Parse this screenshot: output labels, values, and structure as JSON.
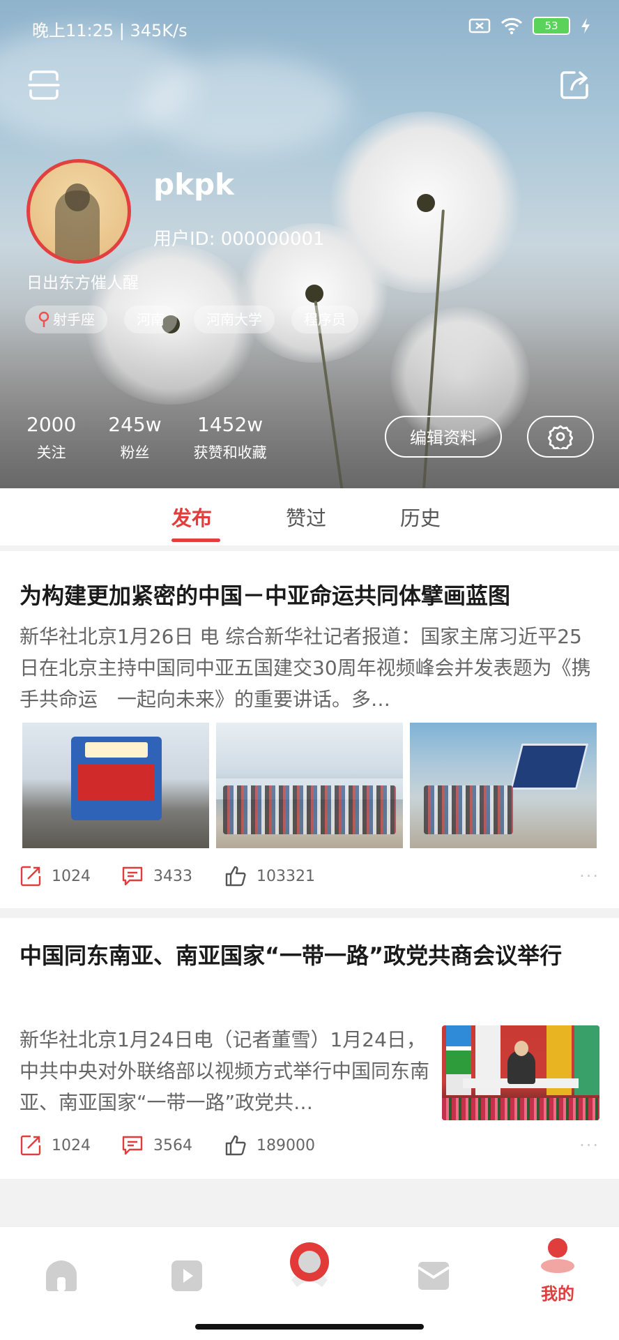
{
  "status_bar": {
    "time_speed": "晚上11:25 | 345K/s",
    "battery": "53",
    "icons": [
      "sim-off-icon",
      "wifi-icon",
      "battery-icon",
      "charging-icon"
    ]
  },
  "header": {
    "scan_icon": "scan-icon",
    "share_icon": "share-icon",
    "username": "pkpk",
    "user_id": "用户ID: 000000001",
    "bio": "日出东方催人醒",
    "tags": [
      "射手座",
      "河南",
      "河南大学",
      "程序员"
    ],
    "stats": [
      {
        "value": "2000",
        "label": "关注"
      },
      {
        "value": "245w",
        "label": "粉丝"
      },
      {
        "value": "1452w",
        "label": "获赞和收藏"
      }
    ],
    "edit_profile": "编辑资料",
    "settings_icon": "gear-icon"
  },
  "tabs": [
    {
      "label": "发布",
      "active": true
    },
    {
      "label": "赞过",
      "active": false
    },
    {
      "label": "历史",
      "active": false
    }
  ],
  "posts": [
    {
      "title": "为构建更加紧密的中国－中亚命运共同体擘画蓝图",
      "body": "新华社北京1月26日 电 综合新华社记者报道：国家主席习近平25日在北京主持中国同中亚五国建交30周年视频峰会并发表题为《携手共命运　一起向未来》的重要讲话。多…",
      "shares": "1024",
      "comments": "3433",
      "likes": "103321"
    },
    {
      "title": "中国同东南亚、南亚国家“一带一路”政党共商会议举行",
      "body": "新华社北京1月24日电（记者董雪）1月24日，中共中央对外联络部以视频方式举行中国同东南亚、南亚国家“一带一路”政党共…",
      "shares": "1024",
      "comments": "3564",
      "likes": "189000"
    }
  ],
  "bottom_nav": {
    "items": [
      "home-icon",
      "video-icon",
      "record-icon",
      "message-icon",
      "profile-icon"
    ],
    "active_label": "我的"
  }
}
